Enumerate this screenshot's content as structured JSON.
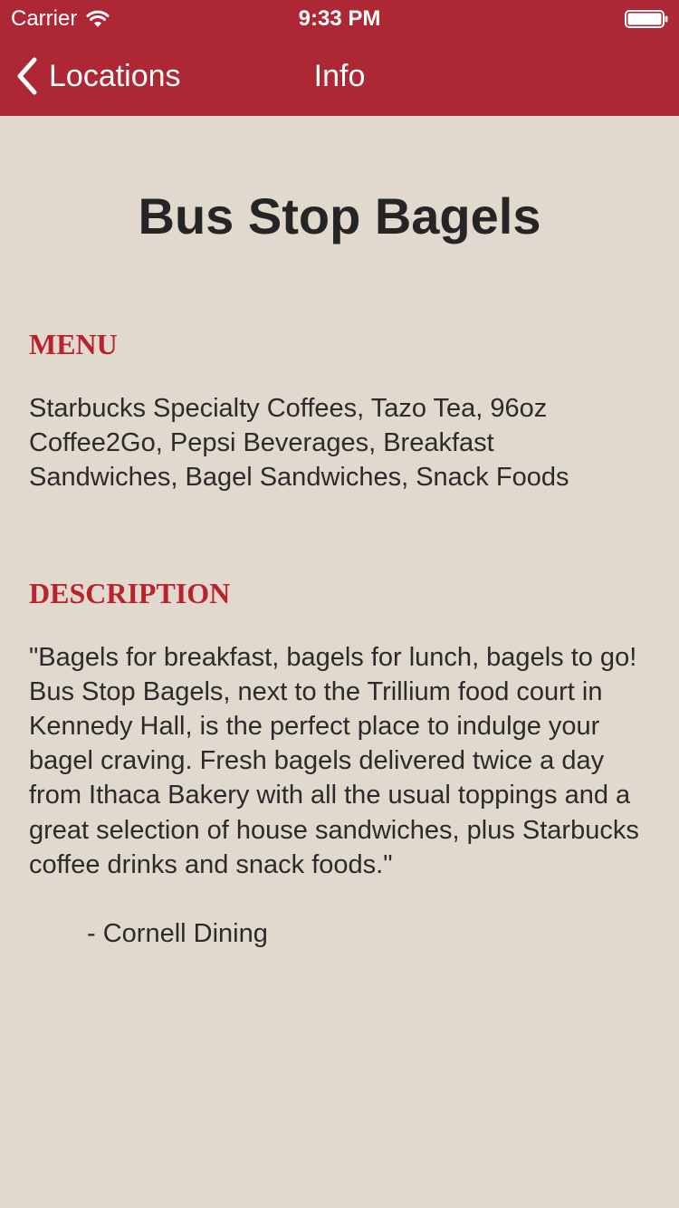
{
  "status_bar": {
    "carrier": "Carrier",
    "time": "9:33 PM"
  },
  "nav": {
    "back_label": "Locations",
    "title": "Info"
  },
  "place": {
    "name": "Bus Stop Bagels"
  },
  "menu": {
    "heading": "MENU",
    "text": "Starbucks Specialty Coffees, Tazo Tea, 96oz Coffee2Go, Pepsi Beverages, Breakfast Sandwiches, Bagel Sandwiches, Snack Foods"
  },
  "description": {
    "heading": "DESCRIPTION",
    "text": "\"Bagels for breakfast, bagels for lunch, bagels to go! Bus Stop Bagels, next to the Trillium food court in Kennedy Hall, is the perfect place to indulge your bagel craving. Fresh bagels delivered twice a day from Ithaca Bakery with all the usual toppings and a great selection of house sandwiches, plus Starbucks coffee drinks and snack foods.\"",
    "attribution": "- Cornell Dining"
  },
  "icons": {
    "back": "chevron-left-icon",
    "wifi": "wifi-icon",
    "battery": "battery-icon"
  },
  "colors": {
    "header_background": "#ad2735",
    "page_background": "#e1d9ce",
    "section_heading": "#b8232f",
    "text": "#222222"
  }
}
